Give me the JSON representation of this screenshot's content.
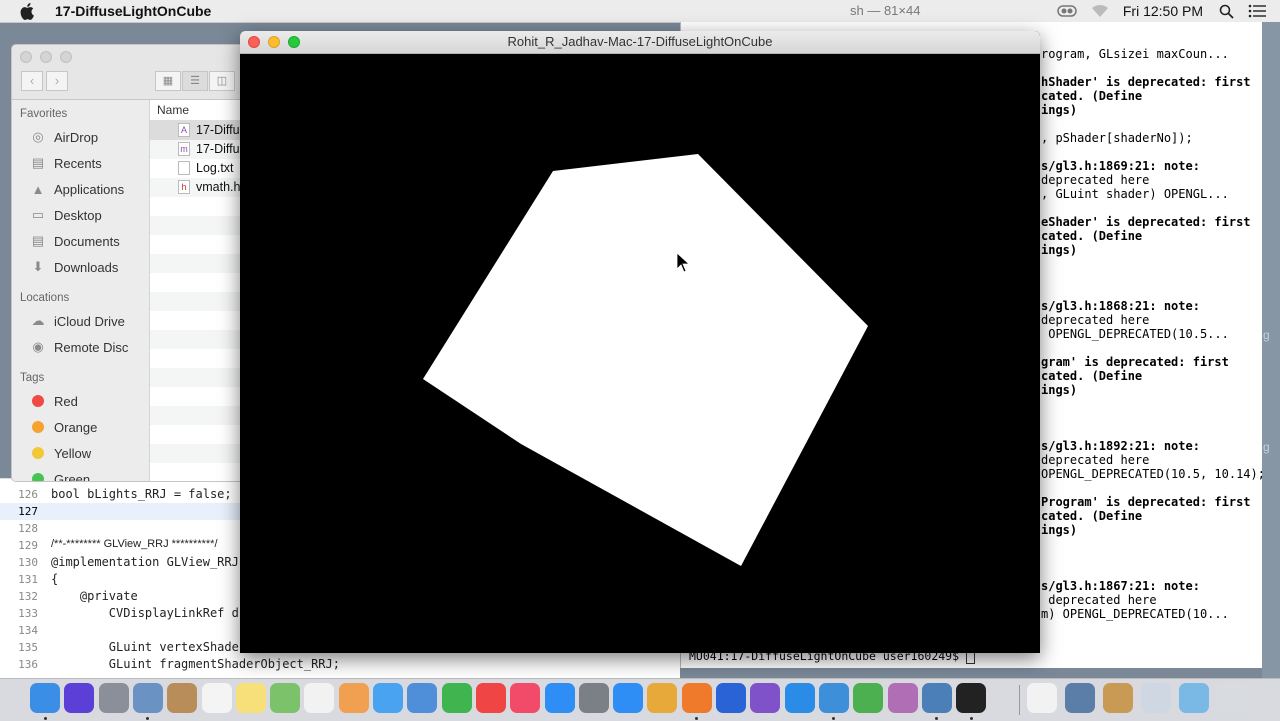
{
  "menubar": {
    "app_name": "17-DiffuseLightOnCube",
    "clock": "Fri 12:50 PM",
    "icons": [
      "apple-icon",
      "visibility-icon",
      "wifi-icon",
      "search-icon",
      "list-icon"
    ]
  },
  "bg_window_title": "sh — 81×44",
  "gl_window": {
    "title": "Rohit_R_Jadhav-Mac-17-DiffuseLightOnCube",
    "fill_color": "#ffffff",
    "background_color": "#000000"
  },
  "finder": {
    "column_name": "Name",
    "favorites_label": "Favorites",
    "favorites": [
      {
        "label": "AirDrop",
        "icon": "airdrop-icon"
      },
      {
        "label": "Recents",
        "icon": "recents-icon"
      },
      {
        "label": "Applications",
        "icon": "applications-icon"
      },
      {
        "label": "Desktop",
        "icon": "desktop-icon"
      },
      {
        "label": "Documents",
        "icon": "documents-icon"
      },
      {
        "label": "Downloads",
        "icon": "downloads-icon"
      }
    ],
    "locations_label": "Locations",
    "locations": [
      {
        "label": "iCloud Drive",
        "icon": "cloud-icon"
      },
      {
        "label": "Remote Disc",
        "icon": "disc-icon"
      }
    ],
    "tags_label": "Tags",
    "tags": [
      {
        "label": "Red",
        "color": "#f04a45"
      },
      {
        "label": "Orange",
        "color": "#f5a22f"
      },
      {
        "label": "Yellow",
        "color": "#f2c834"
      },
      {
        "label": "Green",
        "color": "#44c553"
      }
    ],
    "files": [
      {
        "name": "17-Diffu",
        "icon": "A"
      },
      {
        "name": "17-Diffu",
        "icon": "m"
      },
      {
        "name": "Log.txt",
        "icon": ""
      },
      {
        "name": "vmath.h",
        "icon": "h"
      }
    ]
  },
  "code": {
    "lines": [
      {
        "num": "126",
        "text": "bool bLights_RRJ = false;"
      },
      {
        "num": "127",
        "text": ""
      },
      {
        "num": "128",
        "text": ""
      },
      {
        "num": "129",
        "text": "/**-******** GLView_RRJ **********/"
      },
      {
        "num": "130",
        "text": "@implementation GLView_RRJ"
      },
      {
        "num": "131",
        "text": "{"
      },
      {
        "num": "132",
        "text": "    @private"
      },
      {
        "num": "133",
        "text": "        CVDisplayLinkRef d"
      },
      {
        "num": "134",
        "text": ""
      },
      {
        "num": "135",
        "text": "        GLuint vertexShade"
      },
      {
        "num": "136",
        "text": "        GLuint fragmentShaderObject_RRJ;"
      }
    ]
  },
  "terminal": {
    "lines": [
      {
        "text": "rogram, GLsizei maxCoun...",
        "bold": false
      },
      {
        "text": "",
        "bold": false
      },
      {
        "text": "hShader' is deprecated: first",
        "bold": true
      },
      {
        "text": "cated. (Define",
        "bold": true
      },
      {
        "text": "ings)",
        "bold": true
      },
      {
        "text": "",
        "bold": false
      },
      {
        "text": ", pShader[shaderNo]);",
        "bold": false
      },
      {
        "text": "",
        "bold": false
      },
      {
        "text": "s/gl3.h:1869:21: note:",
        "bold": true
      },
      {
        "text": "deprecated here",
        "bold": false
      },
      {
        "text": ", GLuint shader) OPENGL...",
        "bold": false
      },
      {
        "text": "",
        "bold": false
      },
      {
        "text": "eShader' is deprecated: first",
        "bold": true
      },
      {
        "text": "cated. (Define",
        "bold": true
      },
      {
        "text": "ings)",
        "bold": true
      },
      {
        "text": "",
        "bold": false
      },
      {
        "text": "",
        "bold": false
      },
      {
        "text": "",
        "bold": false
      },
      {
        "text": "s/gl3.h:1868:21: note:",
        "bold": true
      },
      {
        "text": "deprecated here",
        "bold": false
      },
      {
        "text": " OPENGL_DEPRECATED(10.5...",
        "bold": false
      },
      {
        "text": "",
        "bold": false
      },
      {
        "text": "gram' is deprecated: first",
        "bold": true
      },
      {
        "text": "cated. (Define",
        "bold": true
      },
      {
        "text": "ings)",
        "bold": true
      },
      {
        "text": "",
        "bold": false
      },
      {
        "text": "",
        "bold": false
      },
      {
        "text": "",
        "bold": false
      },
      {
        "text": "s/gl3.h:1892:21: note:",
        "bold": true
      },
      {
        "text": "deprecated here",
        "bold": false
      },
      {
        "text": "OPENGL_DEPRECATED(10.5, 10.14);",
        "bold": false
      },
      {
        "text": "",
        "bold": false
      },
      {
        "text": "Program' is deprecated: first",
        "bold": true
      },
      {
        "text": "cated. (Define",
        "bold": true
      },
      {
        "text": "ings)",
        "bold": true
      },
      {
        "text": "",
        "bold": false
      },
      {
        "text": "",
        "bold": false
      },
      {
        "text": "",
        "bold": false
      },
      {
        "text": "s/gl3.h:1867:21: note:",
        "bold": true
      },
      {
        "text": " deprecated here",
        "bold": false
      },
      {
        "text": "m) OPENGL_DEPRECATED(10...",
        "bold": false
      }
    ],
    "prompt": "MU041:17-DiffuseLightOnCube user160249$ "
  },
  "dock": {
    "apps": [
      {
        "name": "finder-icon",
        "color": "#3a8ee6",
        "running": true
      },
      {
        "name": "siri-icon",
        "color": "#5b3fd6",
        "running": false
      },
      {
        "name": "launchpad-icon",
        "color": "#8a8f99",
        "running": false
      },
      {
        "name": "preview-icon",
        "color": "#6a93c4",
        "running": true
      },
      {
        "name": "contacts-icon",
        "color": "#b88d5a",
        "running": false
      },
      {
        "name": "calendar-icon",
        "color": "#f4f4f4",
        "running": false
      },
      {
        "name": "notes-icon",
        "color": "#f7e07a",
        "running": false
      },
      {
        "name": "maps-icon",
        "color": "#7cc26b",
        "running": false
      },
      {
        "name": "reminders-icon",
        "color": "#f2f2f2",
        "running": false
      },
      {
        "name": "photos-icon",
        "color": "#f0a050",
        "running": false
      },
      {
        "name": "messages-icon",
        "color": "#4aa3f0",
        "running": false
      },
      {
        "name": "keynote-icon",
        "color": "#4f8ed8",
        "running": false
      },
      {
        "name": "numbers-icon",
        "color": "#3fb44f",
        "running": false
      },
      {
        "name": "news-icon",
        "color": "#f04545",
        "running": false
      },
      {
        "name": "music-icon",
        "color": "#f24b6a",
        "running": false
      },
      {
        "name": "app-store-icon",
        "color": "#2f8ef5",
        "running": false
      },
      {
        "name": "system-preferences-icon",
        "color": "#7b7f86",
        "running": false
      },
      {
        "name": "safari-icon",
        "color": "#2f8ef5",
        "running": false
      },
      {
        "name": "chrome-icon",
        "color": "#e6a93a",
        "running": false
      },
      {
        "name": "firefox-icon",
        "color": "#ef7a2b",
        "running": true
      },
      {
        "name": "dropbox-icon",
        "color": "#2a63d6",
        "running": false
      },
      {
        "name": "visual-studio-icon",
        "color": "#7f52c9",
        "running": false
      },
      {
        "name": "vscode-icon",
        "color": "#2a8ce6",
        "running": false
      },
      {
        "name": "xcode-icon",
        "color": "#3c8fd8",
        "running": true
      },
      {
        "name": "android-studio-icon",
        "color": "#4caf50",
        "running": false
      },
      {
        "name": "instruments-icon",
        "color": "#b06fb5",
        "running": false
      },
      {
        "name": "xcode-build-icon",
        "color": "#4a7fb8",
        "running": true
      },
      {
        "name": "terminal-icon",
        "color": "#222222",
        "running": true
      }
    ],
    "trailing": [
      {
        "name": "textedit-icon",
        "color": "#f2f2f2"
      },
      {
        "name": "preview-docs-icon",
        "color": "#5b7ea8"
      },
      {
        "name": "archive-icon",
        "color": "#c99a54"
      },
      {
        "name": "app-icon",
        "color": "#cfd8e2"
      },
      {
        "name": "downloads-stack-icon",
        "color": "#7ab8e6"
      },
      {
        "name": "trash-icon",
        "color": "#d8dbe0"
      }
    ]
  }
}
